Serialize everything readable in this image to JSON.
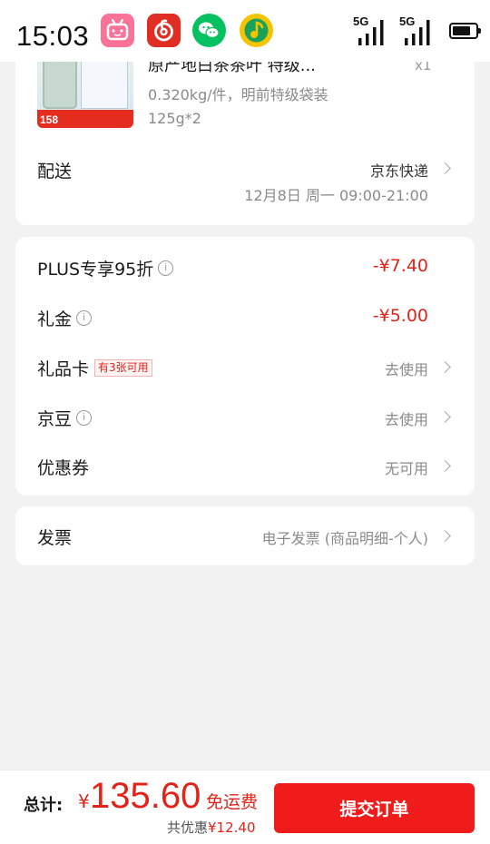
{
  "status_bar": {
    "time": "15:03",
    "apps": [
      "bilibili-icon",
      "netease-music-icon",
      "wechat-icon",
      "qq-music-icon"
    ],
    "signal_1": "5G",
    "signal_2": "5G",
    "battery_level": 0.8
  },
  "product": {
    "title": "原产地白茶茶叶 特级...",
    "qty": "x1",
    "spec": "0.320kg/件，明前特级袋装125g*2",
    "thumb_price": "158"
  },
  "delivery": {
    "label": "配送",
    "carrier": "京东快递",
    "time": "12月8日 周一 09:00-21:00"
  },
  "discounts": {
    "plus": {
      "label": "PLUS专享95折",
      "value": "-¥7.40"
    },
    "gift_money": {
      "label": "礼金",
      "value": "-¥5.00"
    },
    "gift_card": {
      "label": "礼品卡",
      "tag": "有3张可用",
      "action": "去使用"
    },
    "jingdou": {
      "label": "京豆",
      "action": "去使用"
    },
    "coupon": {
      "label": "优惠券",
      "action": "无可用"
    }
  },
  "invoice": {
    "label": "发票",
    "value": "电子发票 (商品明细-个人)"
  },
  "footer": {
    "total_label": "总计:",
    "currency": "¥",
    "total": "135.60",
    "shipping": "免运费",
    "saved_label": "共优惠",
    "saved_amount": "¥12.40",
    "submit_label": "提交订单"
  },
  "colors": {
    "accent_red": "#e2231a",
    "button_red": "#f01c1c",
    "background": "#f2f2f2"
  }
}
